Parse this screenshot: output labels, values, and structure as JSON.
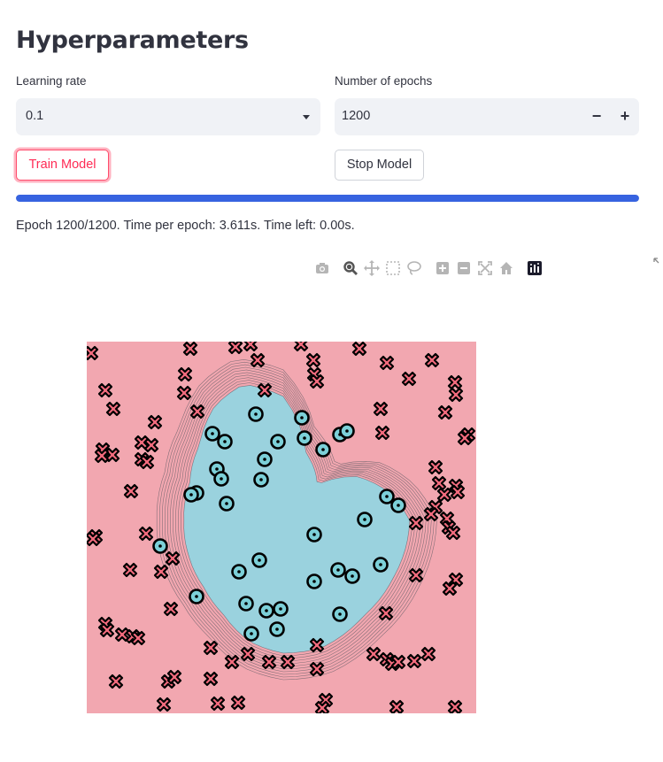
{
  "page": {
    "title": "Hyperparameters"
  },
  "learning_rate": {
    "label": "Learning rate",
    "selected": "0.1"
  },
  "epochs": {
    "label": "Number of epochs",
    "value": "1200",
    "decrement": "−",
    "increment": "+"
  },
  "buttons": {
    "train": "Train Model",
    "stop": "Stop Model"
  },
  "progress": {
    "fraction": 1.0,
    "status": "Epoch 1200/1200. Time per epoch: 3.611s. Time left: 0.00s."
  },
  "modebar": {
    "icons": [
      "camera-icon",
      "zoom-icon",
      "pan-icon",
      "box-select-icon",
      "lasso-icon",
      "zoom-in-icon",
      "zoom-out-icon",
      "autoscale-icon",
      "reset-axes-icon",
      "plotly-logo-icon"
    ]
  },
  "colors": {
    "outside_region": "#f2a7b0",
    "inside_region": "#9ad2de",
    "cross_fill": "#f26b7d",
    "circle_fill": "#7cd0d8",
    "progress": "#3763e0",
    "accent": "#ff4b6b"
  },
  "chart_data": {
    "type": "scatter",
    "title": "",
    "xlabel": "",
    "ylabel": "",
    "xlim": [
      0,
      440
    ],
    "ylim": [
      0,
      420
    ],
    "grid": false,
    "legend": "none",
    "decision_boundary": {
      "inside_class": "circle",
      "outside_class": "cross",
      "contour_levels": 10
    },
    "series": [
      {
        "marker": "circle",
        "points": [
          [
            191,
            82
          ],
          [
            243,
            86
          ],
          [
            142,
            104
          ],
          [
            156,
            113
          ],
          [
            216,
            113
          ],
          [
            246,
            109
          ],
          [
            286,
            105
          ],
          [
            294,
            101
          ],
          [
            267,
            122
          ],
          [
            201,
            133
          ],
          [
            147,
            144
          ],
          [
            152,
            155
          ],
          [
            197,
            156
          ],
          [
            124,
            171
          ],
          [
            118,
            173
          ],
          [
            158,
            183
          ],
          [
            339,
            175
          ],
          [
            352,
            185
          ],
          [
            314,
            201
          ],
          [
            257,
            218
          ],
          [
            83,
            231
          ],
          [
            195,
            247
          ],
          [
            172,
            260
          ],
          [
            332,
            252
          ],
          [
            284,
            258
          ],
          [
            300,
            265
          ],
          [
            257,
            271
          ],
          [
            124,
            288
          ],
          [
            180,
            296
          ],
          [
            203,
            304
          ],
          [
            219,
            302
          ],
          [
            286,
            308
          ],
          [
            215,
            325
          ],
          [
            186,
            330
          ]
        ]
      },
      {
        "marker": "cross",
        "points": [
          [
            117,
            8
          ],
          [
            168,
            6
          ],
          [
            185,
            3
          ],
          [
            242,
            3
          ],
          [
            308,
            8
          ],
          [
            5,
            13
          ],
          [
            193,
            21
          ],
          [
            256,
            21
          ],
          [
            339,
            24
          ],
          [
            390,
            21
          ],
          [
            257,
            37
          ],
          [
            364,
            42
          ],
          [
            260,
            45
          ],
          [
            111,
            37
          ],
          [
            110,
            58
          ],
          [
            201,
            55
          ],
          [
            416,
            46
          ],
          [
            417,
            60
          ],
          [
            21,
            55
          ],
          [
            30,
            76
          ],
          [
            405,
            80
          ],
          [
            125,
            79
          ],
          [
            77,
            91
          ],
          [
            332,
            76
          ],
          [
            334,
            103
          ],
          [
            431,
            105
          ],
          [
            427,
            109
          ],
          [
            62,
            114
          ],
          [
            73,
            117
          ],
          [
            18,
            122
          ],
          [
            29,
            128
          ],
          [
            17,
            129
          ],
          [
            62,
            133
          ],
          [
            68,
            136
          ],
          [
            394,
            142
          ],
          [
            398,
            160
          ],
          [
            417,
            163
          ],
          [
            419,
            170
          ],
          [
            404,
            173
          ],
          [
            50,
            169
          ],
          [
            394,
            187
          ],
          [
            389,
            195
          ],
          [
            407,
            200
          ],
          [
            10,
            220
          ],
          [
            7,
            223
          ],
          [
            67,
            217
          ],
          [
            372,
            205
          ],
          [
            409,
            210
          ],
          [
            414,
            216
          ],
          [
            97,
            245
          ],
          [
            49,
            258
          ],
          [
            84,
            260
          ],
          [
            372,
            264
          ],
          [
            417,
            269
          ],
          [
            410,
            279
          ],
          [
            95,
            302
          ],
          [
            338,
            307
          ],
          [
            21,
            319
          ],
          [
            23,
            326
          ],
          [
            40,
            331
          ],
          [
            52,
            333
          ],
          [
            58,
            335
          ],
          [
            260,
            343
          ],
          [
            140,
            346
          ],
          [
            182,
            353
          ],
          [
            164,
            362
          ],
          [
            206,
            362
          ],
          [
            227,
            362
          ],
          [
            324,
            353
          ],
          [
            339,
            359
          ],
          [
            345,
            364
          ],
          [
            352,
            362
          ],
          [
            370,
            361
          ],
          [
            386,
            353
          ],
          [
            260,
            370
          ],
          [
            140,
            381
          ],
          [
            33,
            384
          ],
          [
            92,
            384
          ],
          [
            99,
            379
          ],
          [
            270,
            405
          ],
          [
            266,
            414
          ],
          [
            148,
            409
          ],
          [
            171,
            408
          ],
          [
            87,
            410
          ],
          [
            350,
            413
          ],
          [
            416,
            413
          ]
        ]
      }
    ]
  }
}
